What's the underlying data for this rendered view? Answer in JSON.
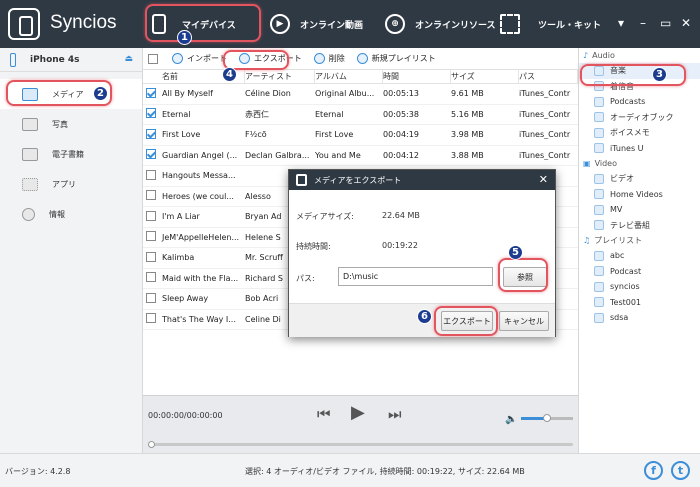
{
  "app": {
    "title": "Syncios"
  },
  "nav": {
    "items": [
      {
        "label": "マイデバイス"
      },
      {
        "label": "オンライン動画"
      },
      {
        "label": "オンラインリソース"
      },
      {
        "label": "ツール・キット"
      }
    ]
  },
  "device": {
    "name": "iPhone 4s"
  },
  "sidebar": {
    "items": [
      {
        "label": "メディア"
      },
      {
        "label": "写真"
      },
      {
        "label": "電子書籍"
      },
      {
        "label": "アプリ"
      },
      {
        "label": "情報"
      }
    ]
  },
  "toolbar": {
    "import_label": "インポート",
    "export_label": "エクスポート",
    "delete_label": "削除",
    "new_playlist_label": "新規プレイリスト"
  },
  "table": {
    "columns": [
      "名前",
      "アーティスト",
      "アルバム",
      "時間",
      "サイズ",
      "パス"
    ],
    "rows": [
      {
        "checked": true,
        "name": "All By Myself",
        "artist": "Céline Dion",
        "album": "Original Albu...",
        "time": "00:05:13",
        "size": "9.61 MB",
        "path": "iTunes_Contr"
      },
      {
        "checked": true,
        "name": "Eternal",
        "artist": "赤西仁",
        "album": "Eternal",
        "time": "00:05:38",
        "size": "5.16 MB",
        "path": "iTunes_Contr"
      },
      {
        "checked": true,
        "name": "First Love",
        "artist": "F½cõ",
        "album": "First Love",
        "time": "00:04:19",
        "size": "3.98 MB",
        "path": "iTunes_Contr"
      },
      {
        "checked": true,
        "name": "Guardian Angel (...",
        "artist": "Declan Galbra...",
        "album": "You and Me",
        "time": "00:04:12",
        "size": "3.88 MB",
        "path": "iTunes_Contr"
      },
      {
        "checked": false,
        "name": "Hangouts Messa...",
        "artist": "",
        "album": "",
        "time": "",
        "size": "",
        "path": ""
      },
      {
        "checked": false,
        "name": "Heroes (we coul...",
        "artist": "Alesso",
        "album": "",
        "time": "",
        "size": "",
        "path": ""
      },
      {
        "checked": false,
        "name": "I'm A Liar",
        "artist": "Bryan Ad",
        "album": "",
        "time": "",
        "size": "",
        "path": ""
      },
      {
        "checked": false,
        "name": "JeM'AppelleHelen...",
        "artist": "Helene S",
        "album": "",
        "time": "",
        "size": "",
        "path": ""
      },
      {
        "checked": false,
        "name": "Kalimba",
        "artist": "Mr. Scruff",
        "album": "",
        "time": "",
        "size": "",
        "path": ""
      },
      {
        "checked": false,
        "name": "Maid with the Fla...",
        "artist": "Richard S",
        "album": "",
        "time": "",
        "size": "",
        "path": ""
      },
      {
        "checked": false,
        "name": "Sleep Away",
        "artist": "Bob Acri",
        "album": "",
        "time": "",
        "size": "",
        "path": ""
      },
      {
        "checked": false,
        "name": "That's The Way I...",
        "artist": "Celine Di",
        "album": "",
        "time": "",
        "size": "",
        "path": ""
      }
    ]
  },
  "player": {
    "time": "00:00:00/00:00:00",
    "volume_fraction": 0.5,
    "progress_fraction": 0
  },
  "right_panel": {
    "audio_header": "Audio",
    "audio_items": [
      {
        "label": "音楽"
      },
      {
        "label": "着信音"
      },
      {
        "label": "Podcasts"
      },
      {
        "label": "オーディオブック"
      },
      {
        "label": "ボイスメモ"
      },
      {
        "label": "iTunes U"
      }
    ],
    "video_header": "Video",
    "video_items": [
      {
        "label": "ビデオ"
      },
      {
        "label": "Home Videos"
      },
      {
        "label": "MV"
      },
      {
        "label": "テレビ番組"
      }
    ],
    "playlist_header": "プレイリスト",
    "playlist_items": [
      {
        "label": "abc"
      },
      {
        "label": "Podcast"
      },
      {
        "label": "syncios"
      },
      {
        "label": "Test001"
      },
      {
        "label": "sdsa"
      }
    ]
  },
  "dialog": {
    "title": "メディアをエクスポート",
    "media_size_label": "メディアサイズ:",
    "media_size_value": "22.64 MB",
    "duration_label": "持続時間:",
    "duration_value": "00:19:22",
    "path_label": "パス:",
    "path_value": "D:\\music",
    "browse_label": "参照",
    "export_label": "エクスポート",
    "cancel_label": "キャンセル"
  },
  "status": {
    "version": "バージョン: 4.2.8",
    "selection": "選択: 4 オーディオ/ビデオ ファイル, 持続時間: 00:19:22, サイズ: 22.64 MB"
  },
  "social": {
    "facebook": "f",
    "twitter": "t"
  },
  "badges": [
    "1",
    "2",
    "3",
    "4",
    "5",
    "6"
  ],
  "colors": {
    "accent": "#3b8ed8",
    "topbar": "#2f3944",
    "highlight": "#e2555f",
    "badge": "#1c3d8f"
  }
}
